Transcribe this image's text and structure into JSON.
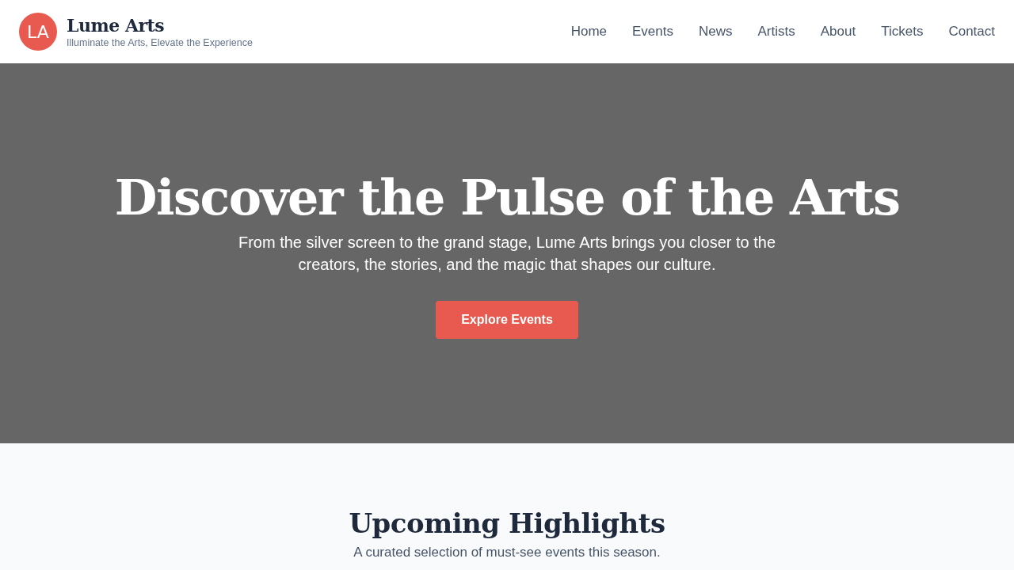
{
  "header": {
    "logo_initials": "LA",
    "brand_name": "Lume Arts",
    "tagline": "Illuminate the Arts, Elevate the Experience"
  },
  "nav": [
    "Home",
    "Events",
    "News",
    "Artists",
    "About",
    "Tickets",
    "Contact"
  ],
  "hero": {
    "title": "Discover the Pulse of the Arts",
    "subtitle": "From the silver screen to the grand stage, Lume Arts brings you closer to the creators, the stories, and the magic that shapes our culture.",
    "button": "Explore Events"
  },
  "highlights": {
    "title": "Upcoming Highlights",
    "subtitle": "A curated selection of must-see events this season."
  }
}
